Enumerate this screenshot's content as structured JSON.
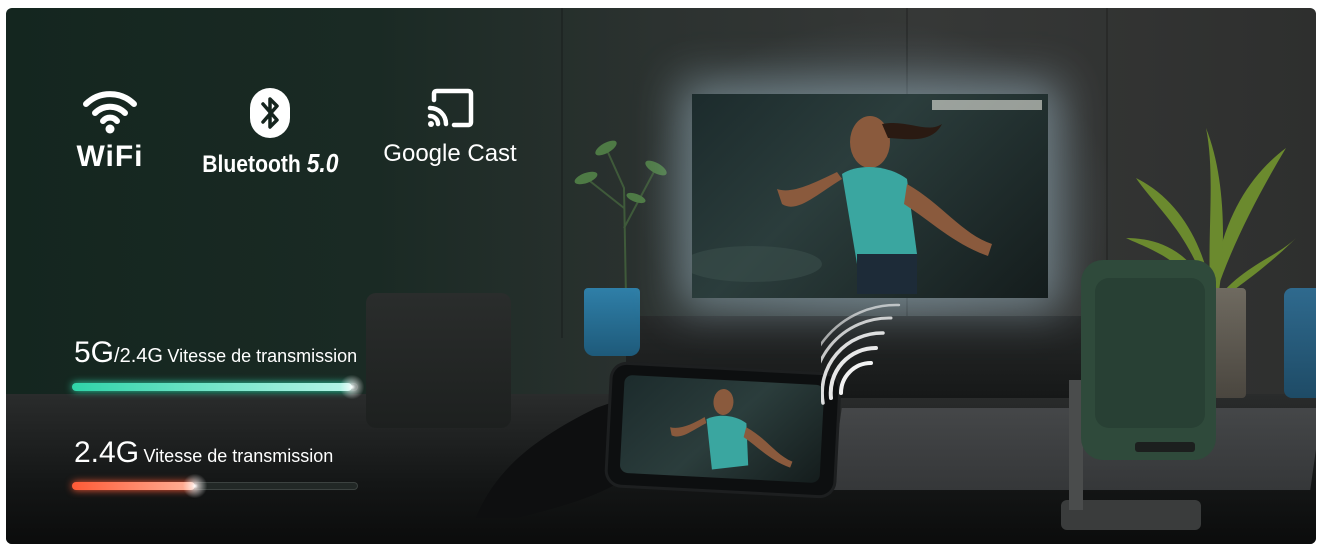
{
  "features": [
    {
      "icon": "wifi-icon",
      "label": "WiFi"
    },
    {
      "icon": "bluetooth-icon",
      "label": "Bluetooth",
      "version": "5.0"
    },
    {
      "icon": "cast-icon",
      "label": "Google Cast"
    }
  ],
  "speeds": [
    {
      "band_main": "5G",
      "band_secondary": "/2.4G",
      "label": "Vitesse de transmission",
      "fill_fraction": 0.98,
      "color_start": "#2fd3a8",
      "color_end": "#b8f5e8"
    },
    {
      "band_main": "2.4G",
      "band_secondary": "",
      "label": "Vitesse de transmission",
      "fill_fraction": 0.43,
      "color_start": "#ff5a36",
      "color_end": "#ffb39a"
    }
  ],
  "colors": {
    "accent_green": "#2fd3a8",
    "accent_red": "#ff5a36",
    "text": "#ffffff"
  }
}
